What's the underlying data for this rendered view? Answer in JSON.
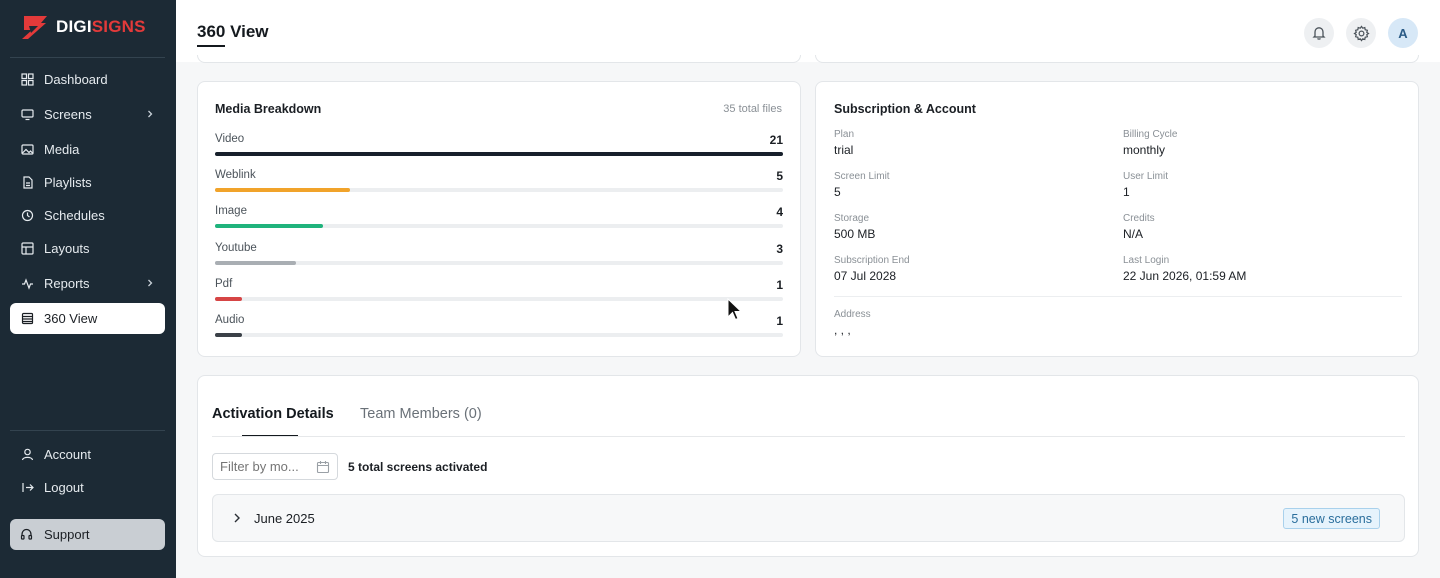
{
  "brand": {
    "part1": "DIGI",
    "part2": "SIGNS",
    "accent": "#e33a3a"
  },
  "sidebar": {
    "items": [
      {
        "label": "Dashboard",
        "icon": "grid-icon"
      },
      {
        "label": "Screens",
        "icon": "monitor-icon",
        "expandable": true
      },
      {
        "label": "Media",
        "icon": "image-icon"
      },
      {
        "label": "Playlists",
        "icon": "file-icon"
      },
      {
        "label": "Schedules",
        "icon": "clock-icon"
      },
      {
        "label": "Layouts",
        "icon": "layout-icon"
      },
      {
        "label": "Reports",
        "icon": "activity-icon",
        "expandable": true
      },
      {
        "label": "360 View",
        "icon": "table-icon",
        "active": true
      }
    ],
    "bottom": [
      {
        "label": "Account",
        "icon": "user-icon"
      },
      {
        "label": "Logout",
        "icon": "logout-icon"
      }
    ],
    "support": "Support"
  },
  "header": {
    "title": "360 View",
    "avatar_initial": "A"
  },
  "media": {
    "title": "Media Breakdown",
    "total": "35 total files",
    "rows": [
      {
        "label": "Video",
        "count": "21",
        "fraction": 1.0,
        "color": "#17202b"
      },
      {
        "label": "Weblink",
        "count": "5",
        "fraction": 0.238,
        "color": "#f1a32a"
      },
      {
        "label": "Image",
        "count": "4",
        "fraction": 0.19,
        "color": "#1fb37c"
      },
      {
        "label": "Youtube",
        "count": "3",
        "fraction": 0.143,
        "color": "#a9aeb3"
      },
      {
        "label": "Pdf",
        "count": "1",
        "fraction": 0.048,
        "color": "#d64545"
      },
      {
        "label": "Audio",
        "count": "1",
        "fraction": 0.048,
        "color": "#3b4148"
      }
    ]
  },
  "subscription": {
    "title": "Subscription & Account",
    "fields": [
      {
        "label": "Plan",
        "value": "trial"
      },
      {
        "label": "Billing Cycle",
        "value": "monthly"
      },
      {
        "label": "Screen Limit",
        "value": "5"
      },
      {
        "label": "User Limit",
        "value": "1"
      },
      {
        "label": "Storage",
        "value": "500 MB"
      },
      {
        "label": "Credits",
        "value": "N/A"
      },
      {
        "label": "Subscription End",
        "value": "07 Jul 2028"
      },
      {
        "label": "Last Login",
        "value": "22 Jun 2026, 01:59 AM"
      }
    ],
    "address": {
      "label": "Address",
      "value": ", , ,"
    }
  },
  "activation": {
    "tabs": [
      "Activation Details",
      "Team Members (0)"
    ],
    "filter_placeholder": "Filter by mo...",
    "count_text": "5 total screens activated",
    "month": "June 2025",
    "badge": "5 new screens"
  }
}
